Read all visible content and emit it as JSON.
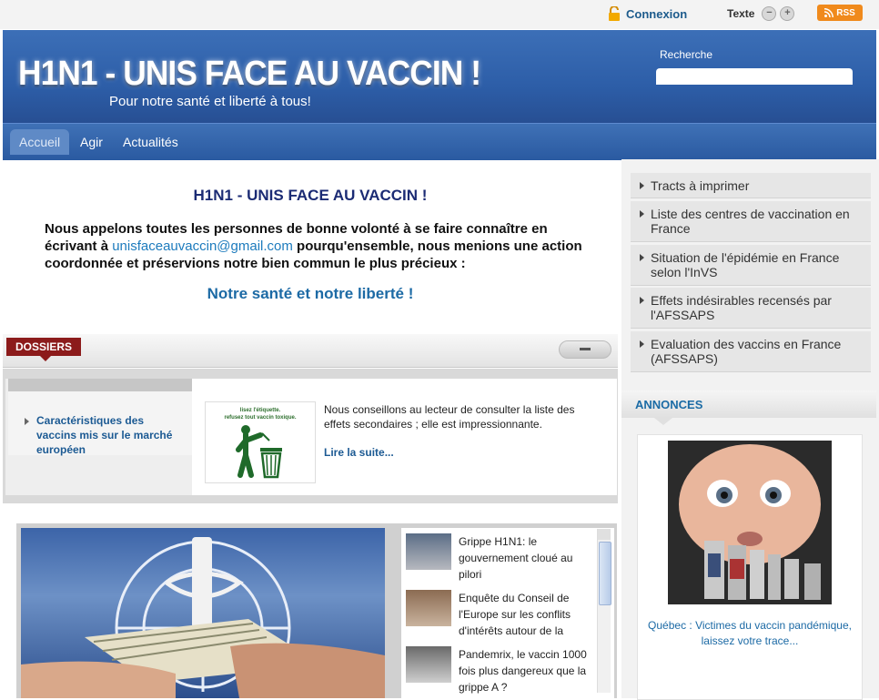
{
  "topbar": {
    "login_label": "Connexion",
    "text_size_label": "Texte",
    "text_decrease": "−",
    "text_increase": "+",
    "rss_label": "RSS"
  },
  "header": {
    "site_title": "H1N1 - UNIS FACE AU VACCIN !",
    "tagline": "Pour notre santé et liberté à tous!",
    "search_label": "Recherche",
    "search_value": ""
  },
  "nav": {
    "items": [
      {
        "label": "Accueil",
        "active": true
      },
      {
        "label": "Agir",
        "active": false
      },
      {
        "label": "Actualités",
        "active": false
      }
    ]
  },
  "intro": {
    "title": "H1N1 - UNIS FACE AU VACCIN !",
    "text_before_email": "Nous appelons toutes les personnes de bonne volonté à se faire connaître en écrivant à",
    "email": "unisfaceauvaccin@gmail.com",
    "text_after_email": "pourqu'ensemble, nous menions une action coordonnée et préservions notre bien commun le plus précieux :",
    "slogan": "Notre santé et notre liberté !"
  },
  "dossiers": {
    "tab_label": "DOSSIERS",
    "item_label": "Caractéristiques des vaccins mis sur le marché européen",
    "thumb_caption_1": "lisez l'étiquette.",
    "thumb_caption_2": "refusez tout vaccin toxique.",
    "description": "Nous conseillons au lecteur de consulter la liste des effets secondaires ; elle est impressionnante.",
    "read_more": "Lire la suite..."
  },
  "slider": {
    "news": [
      {
        "text": "Grippe H1N1: le gouvernement cloué au pilori"
      },
      {
        "text": "Enquête du Conseil de l'Europe sur les conflits d'intérêts autour de la"
      },
      {
        "text": "Pandemrix, le vaccin 1000 fois plus dangereux que la grippe A ?"
      }
    ]
  },
  "sidebar": {
    "links": [
      {
        "label": "Tracts à imprimer"
      },
      {
        "label": "Liste des centres de vaccination en France"
      },
      {
        "label": "Situation de l'épidémie en France selon l'InVS"
      },
      {
        "label": "Effets indésirables recensés par l'AFSSAPS"
      },
      {
        "label": "Evaluation des vaccins en France (AFSSAPS)"
      }
    ],
    "annonces_title": "ANNONCES",
    "annonce_caption": "Québec : Victimes du vaccin pandémique, laissez votre trace..."
  },
  "colors": {
    "header_blue": "#2d5ea8",
    "link_blue": "#1c6aa5",
    "dossier_red": "#8c1b1b",
    "rss_orange": "#f08a1c"
  },
  "icons": [
    "lock-icon",
    "rss-icon",
    "minus-icon",
    "plus-icon",
    "collapse-icon",
    "recycle-bin-icon"
  ]
}
